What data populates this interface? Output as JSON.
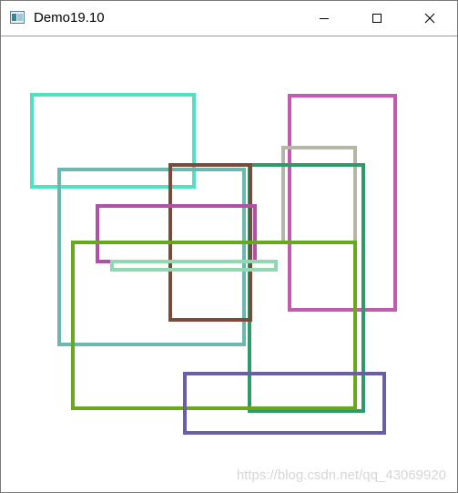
{
  "window": {
    "title": "Demo19.10"
  },
  "controls": {
    "minimize_icon": "minimize-icon",
    "maximize_icon": "maximize-icon",
    "close_icon": "close-icon"
  },
  "rectangles": [
    {
      "name": "rect-teal-top-left",
      "color": "#4de2c0"
    },
    {
      "name": "rect-pink-right",
      "color": "#c15bb0"
    },
    {
      "name": "rect-grey-right",
      "color": "#b6b6a8"
    },
    {
      "name": "rect-slate-teal",
      "color": "#6cb8b0"
    },
    {
      "name": "rect-dark-green",
      "color": "#2e9a6a"
    },
    {
      "name": "rect-brown",
      "color": "#7a4a3a"
    },
    {
      "name": "rect-purple-small",
      "color": "#b150a8"
    },
    {
      "name": "rect-mint-thin",
      "color": "#90d8b0"
    },
    {
      "name": "rect-olive-green",
      "color": "#68a81e"
    },
    {
      "name": "rect-indigo-bottom",
      "color": "#6a5ea6"
    }
  ],
  "watermark": "https://blog.csdn.net/qq_43069920"
}
